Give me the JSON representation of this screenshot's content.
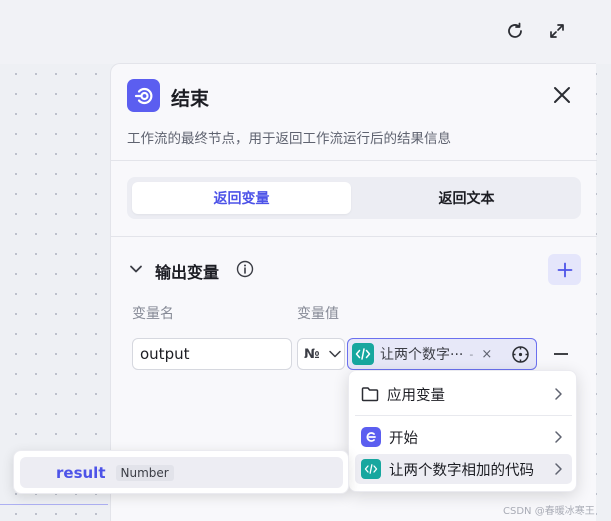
{
  "toolbar": {
    "refresh_icon": "refresh-icon",
    "expand_icon": "expand-icon"
  },
  "panel": {
    "title": "结束",
    "description": "工作流的最终节点，用于返回工作流运行后的结果信息",
    "tabs": [
      {
        "label": "返回变量",
        "active": true
      },
      {
        "label": "返回文本",
        "active": false
      }
    ],
    "section_title": "输出变量",
    "columns": {
      "name": "变量名",
      "value": "变量值"
    },
    "row": {
      "name": "output",
      "type_symbol": "№",
      "ref_text": "让两个数字···",
      "ref_dash": "-",
      "ref_clear": "×"
    }
  },
  "dropdown": {
    "items": [
      {
        "label": "应用变量",
        "icon": "folder-icon"
      },
      {
        "label": "开始",
        "icon": "start-node-icon"
      },
      {
        "label": "让两个数字相加的代码",
        "icon": "code-node-icon"
      }
    ]
  },
  "submenu": {
    "name": "result",
    "type": "Number"
  },
  "watermark": "CSDN @春暖冰寒王",
  "colors": {
    "accent": "#4d53e8",
    "header_icon": "#5b5ef0",
    "code_icon": "#17a79f"
  }
}
